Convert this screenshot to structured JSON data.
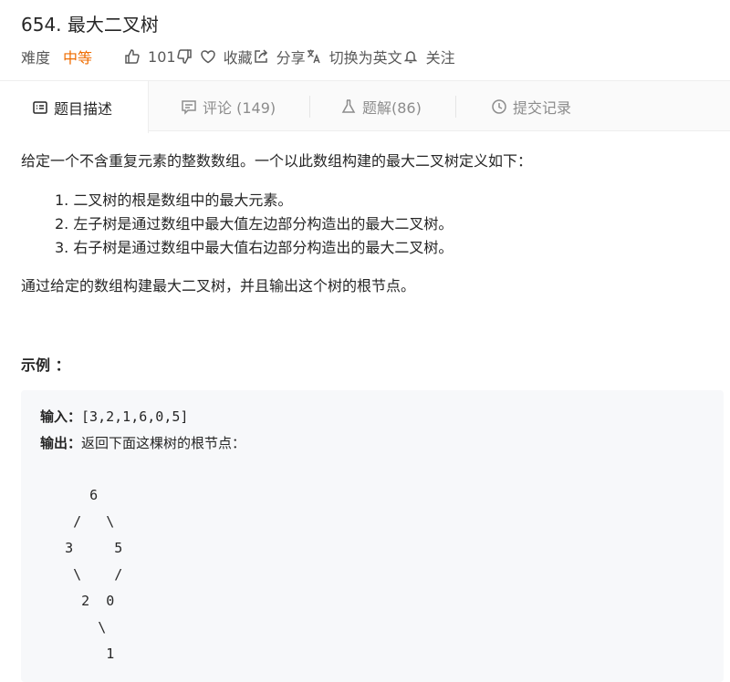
{
  "problem": {
    "title": "654. 最大二叉树",
    "difficulty_label": "难度",
    "difficulty_value": "中等",
    "likes": "101",
    "collect_label": "收藏",
    "share_label": "分享",
    "switch_lang_label": "切换为英文",
    "follow_label": "关注"
  },
  "tabs": [
    {
      "label": "题目描述",
      "icon": "description-icon",
      "active": true
    },
    {
      "label": "评论 (149)",
      "icon": "comment-icon",
      "active": false
    },
    {
      "label": "题解(86)",
      "icon": "flask-icon",
      "active": false
    },
    {
      "label": "提交记录",
      "icon": "clock-icon",
      "active": false
    }
  ],
  "description": {
    "intro": "给定一个不含重复元素的整数数组。一个以此数组构建的最大二叉树定义如下：",
    "rules": [
      "1. 二叉树的根是数组中的最大元素。",
      "2. 左子树是通过数组中最大值左边部分构造出的最大二叉树。",
      "3. 右子树是通过数组中最大值右边部分构造出的最大二叉树。"
    ],
    "task": "通过给定的数组构建最大二叉树，并且输出这个树的根节点。",
    "example_heading": "示例 ："
  },
  "example": {
    "input_label": "输入：",
    "input_value": "[3,2,1,6,0,5]",
    "output_label": "输出：",
    "output_value": "返回下面这棵树的根节点：",
    "tree_lines": [
      "      6",
      "    /   \\",
      "   3     5",
      "    \\    /",
      "     2  0",
      "       \\",
      "        1"
    ]
  },
  "colors": {
    "accent_orange": "#ef6c00",
    "tab_bg": "#fafafa",
    "code_bg": "#f7f8fa"
  }
}
